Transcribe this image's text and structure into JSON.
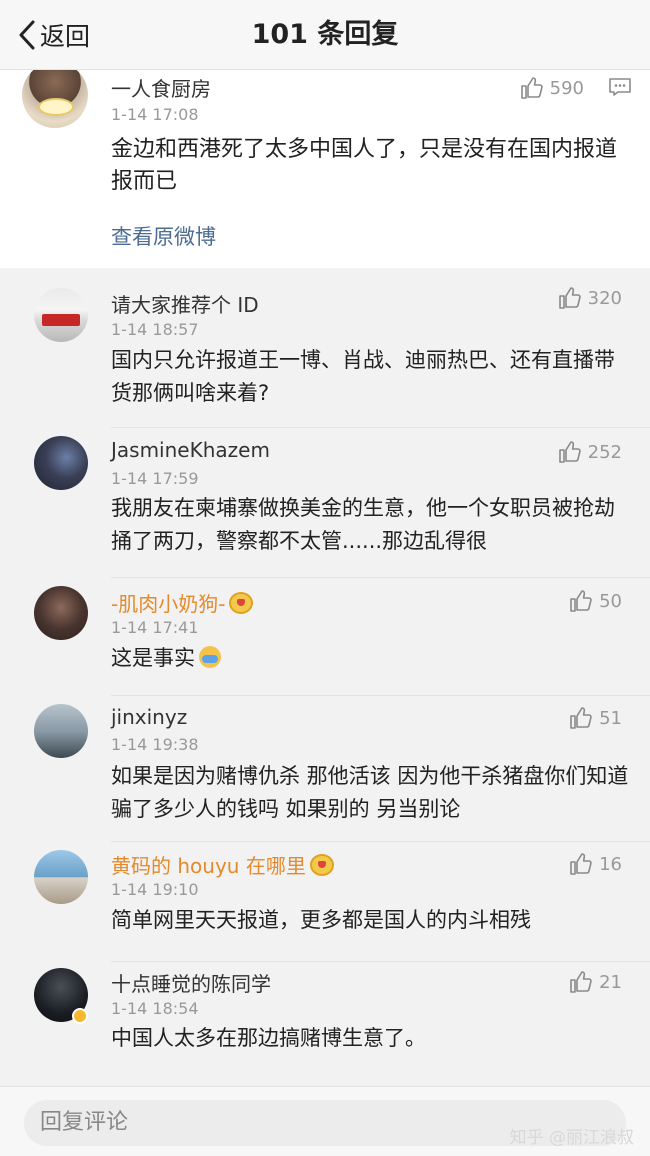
{
  "header": {
    "back_label": "返回",
    "title": "101 条回复"
  },
  "main_comment": {
    "username": "一人食厨房",
    "time": "1-14 17:08",
    "likes": "590",
    "content": "金边和西港死了太多中国人了，只是没有在国内报道报而已",
    "view_original": "查看原微博"
  },
  "replies": [
    {
      "username": "请大家推荐个 ID",
      "time": "1-14 18:57",
      "likes": "320",
      "content": "国内只允许报道王一博、肖战、迪丽热巴、还有直播带货那俩叫啥来着?"
    },
    {
      "username": "JasmineKhazem",
      "time": "1-14 17:59",
      "likes": "252",
      "content": "我朋友在柬埔寨做换美金的生意，他一个女职员被抢劫捅了两刀，警察都不太管......那边乱得很"
    },
    {
      "username": "-肌肉小奶狗-",
      "time": "1-14 17:41",
      "likes": "50",
      "content": "这是事实"
    },
    {
      "username": "jinxinyz",
      "time": "1-14 19:38",
      "likes": "51",
      "content": "如果是因为赌博仇杀 那他活该 因为他干杀猪盘你们知道骗了多少人的钱吗  如果别的 另当别论"
    },
    {
      "username": "黄码的 houyu 在哪里",
      "time": "1-14 19:10",
      "likes": "16",
      "content": "简单网里天天报道，更多都是国人的内斗相残"
    },
    {
      "username": "十点睡觉的陈同学",
      "time": "1-14 18:54",
      "likes": "21",
      "content": "中国人太多在那边搞赌博生意了。"
    }
  ],
  "footer": {
    "reply_placeholder": "回复评论",
    "watermark": "知乎 @丽江浪叔"
  },
  "colors": {
    "link": "#4d6c93",
    "vip_name": "#e58a2b",
    "muted": "#999999"
  },
  "icons": [
    "back-chevron-icon",
    "thumbs-up-icon",
    "more-comment-icon",
    "vip-badge-icon",
    "emoji-icon",
    "verified-icon"
  ]
}
